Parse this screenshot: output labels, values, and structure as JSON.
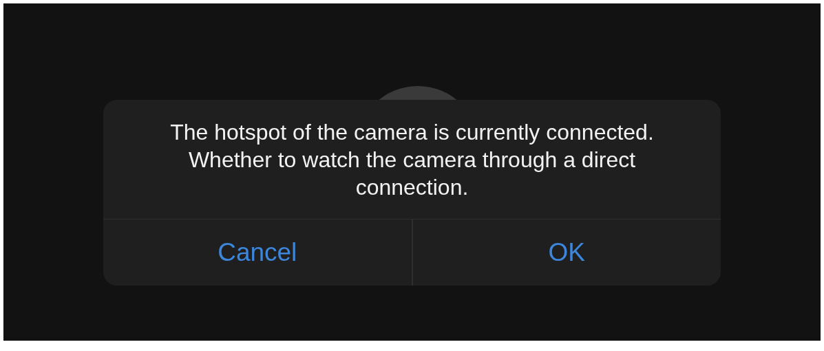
{
  "dialog": {
    "message": "The hotspot of the camera is currently connected. Whether to watch the camera through a direct connection.",
    "buttons": [
      {
        "label": "Cancel"
      },
      {
        "label": "OK"
      }
    ]
  }
}
